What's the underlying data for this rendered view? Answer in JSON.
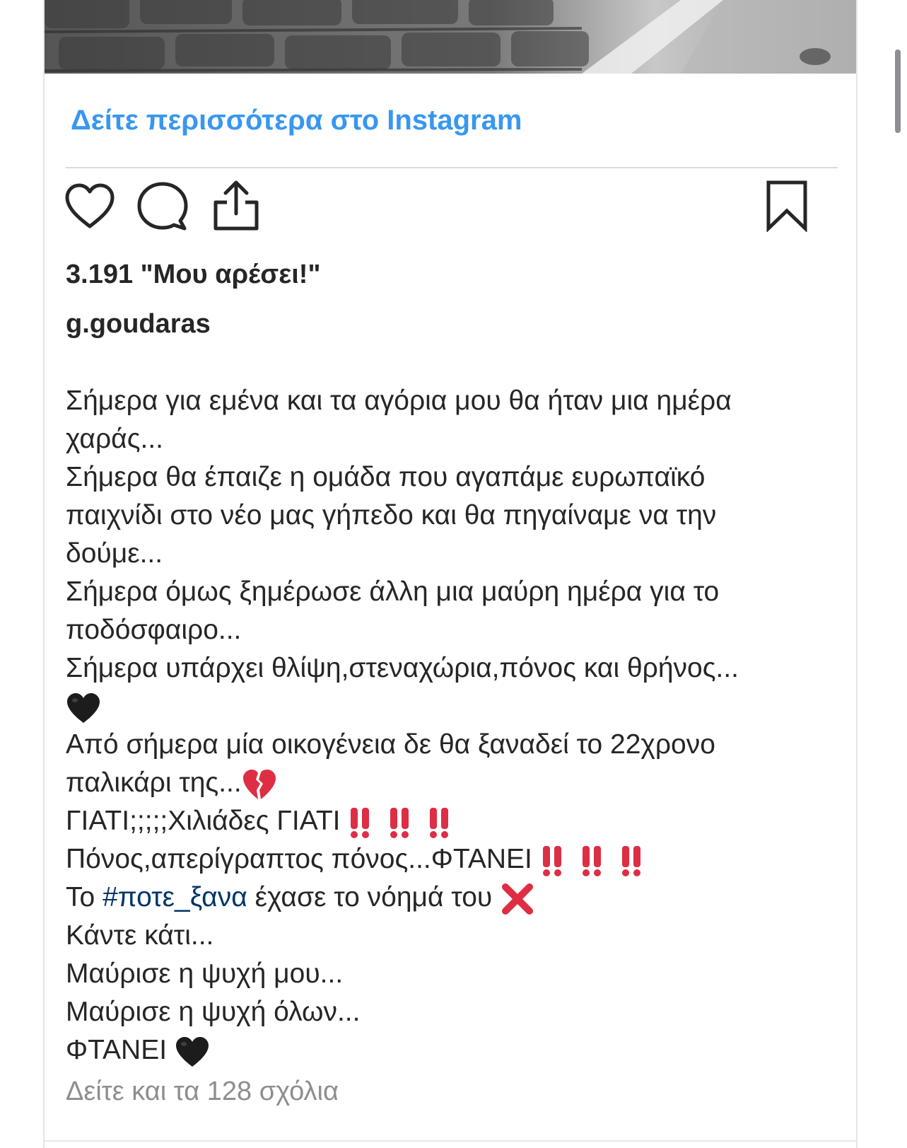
{
  "post": {
    "see_more_label": "Δείτε περισσότερα στο Instagram",
    "likes_text": "3.191 \"Μου αρέσει!\"",
    "username": "g.goudaras",
    "caption": {
      "l1": "Σήμερα για εμένα και τα αγόρια μου θα ήταν μια ημέρα",
      "l2": "χαράς...",
      "l3": "Σήμερα θα έπαιζε η ομάδα που αγαπάμε ευρωπαϊκό",
      "l4": "παιχνίδι στο νέο μας γήπεδο και θα πηγαίναμε να την",
      "l5": "δούμε...",
      "l6": "Σήμερα όμως ξημέρωσε άλλη μια μαύρη ημέρα για το",
      "l7": "ποδόσφαιρο...",
      "l8": "Σήμερα υπάρχει θλίψη,στεναχώρια,πόνος και θρήνος...",
      "l10": "Από σήμερα μία οικογένεια δε θα ξαναδεί το 22χρονο",
      "l11": "παλικάρι της...",
      "l12": "ΓΙΑΤΙ;;;;;Χιλιάδες ΓΙΑΤΙ ",
      "l13": "Πόνος,απερίγραπτος πόνος...ΦΤΑΝΕΙ ",
      "l14_pre": "Το ",
      "l14_hashtag": "#ποτε_ξανα",
      "l14_post": " έχασε το νόημά του ",
      "l15": "Κάντε κάτι...",
      "l16": "Μαύρισε η ψυχή μου...",
      "l17": "Μαύρισε η ψυχή όλων...",
      "l18": "ΦΤΑΝΕΙ "
    },
    "view_comments_label": "Δείτε και τα 128 σχόλια"
  },
  "colors": {
    "link_blue": "#3897f0",
    "hashtag_blue": "#003569",
    "text": "#262626",
    "muted": "#8e8e8e",
    "emoji_red": "#dd2e44"
  },
  "icons": [
    "heart-icon",
    "comment-icon",
    "share-icon",
    "bookmark-icon",
    "black-heart-emoji",
    "broken-heart-emoji",
    "double-exclamation-emoji",
    "cross-mark-emoji"
  ]
}
